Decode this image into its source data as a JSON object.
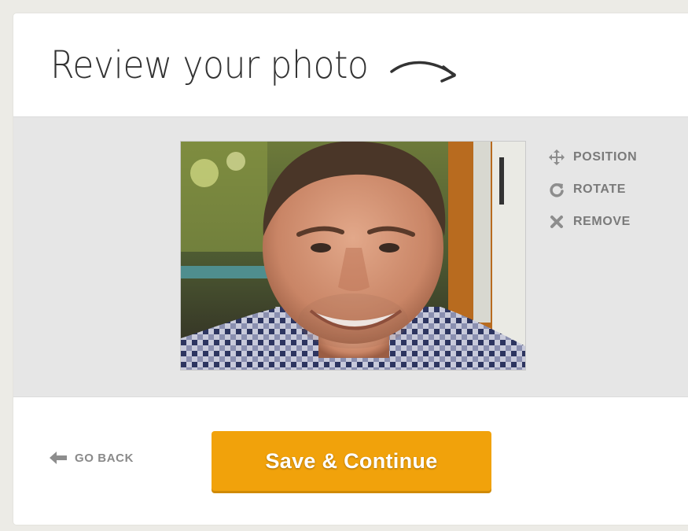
{
  "header": {
    "title": "Review your photo",
    "arrow_icon": "curved-arrow-right-icon"
  },
  "photo": {
    "alt": "User photo: smiling man in a checkered shirt"
  },
  "tools": [
    {
      "label": "POSITION",
      "icon": "move-arrows-icon"
    },
    {
      "label": "ROTATE",
      "icon": "rotate-icon"
    },
    {
      "label": "REMOVE",
      "icon": "close-x-icon"
    }
  ],
  "footer": {
    "go_back_label": "GO BACK",
    "go_back_icon": "arrow-left-icon",
    "save_label": "Save & Continue"
  },
  "colors": {
    "accent": "#f1a20b",
    "muted_text": "#7a7a7a",
    "panel_bg": "#e6e6e6"
  }
}
